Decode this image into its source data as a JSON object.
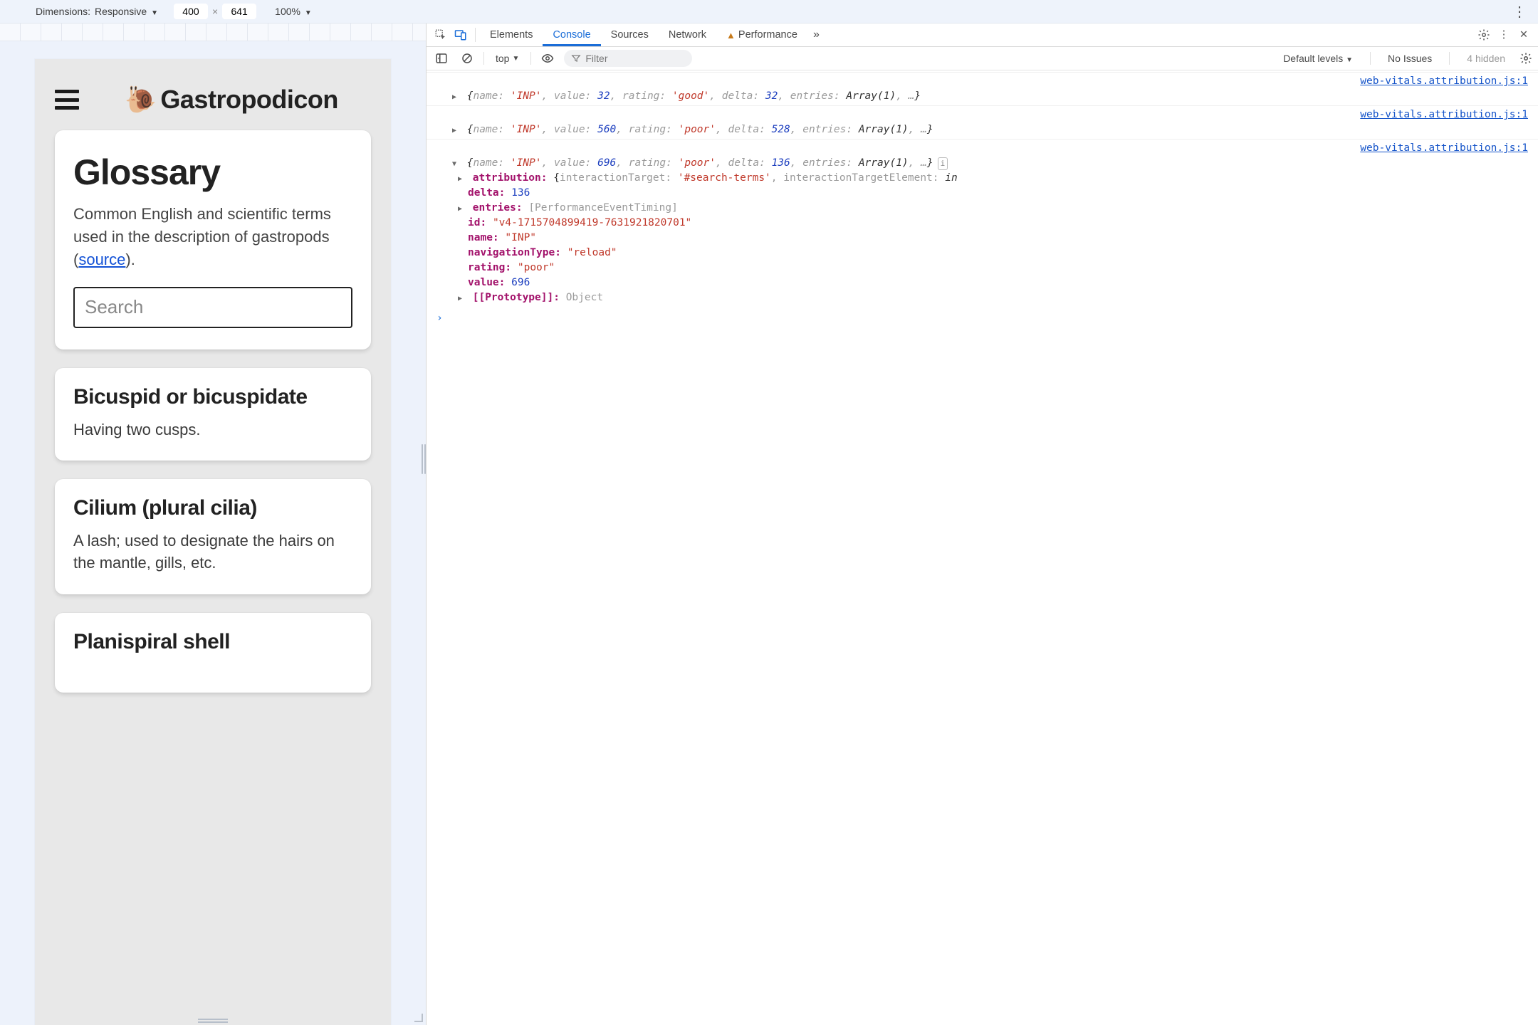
{
  "device_bar": {
    "dimensions_label": "Dimensions:",
    "device_name": "Responsive",
    "width": "400",
    "height": "641",
    "zoom": "100%"
  },
  "site": {
    "title": "Gastropodicon",
    "page_title": "Glossary",
    "lead_pre": "Common English and scientific terms used in the description of gastropods (",
    "lead_link": "source",
    "lead_post": ").",
    "search_placeholder": "Search",
    "terms": [
      {
        "title": "Bicuspid or bicuspidate",
        "def": "Having two cusps."
      },
      {
        "title": "Cilium (plural cilia)",
        "def": "A lash; used to designate the hairs on the mantle, gills, etc."
      },
      {
        "title": "Planispiral shell",
        "def": ""
      }
    ]
  },
  "devtools": {
    "tabs": {
      "elements": "Elements",
      "console": "Console",
      "sources": "Sources",
      "network": "Network",
      "performance": "Performance"
    },
    "toolbar": {
      "context": "top",
      "filter_placeholder": "Filter",
      "levels": "Default levels",
      "no_issues": "No Issues",
      "hidden": "4 hidden"
    },
    "source_link": "web-vitals.attribution.js:1",
    "logs": [
      {
        "expanded": false,
        "summary": [
          {
            "t": "brace",
            "v": "{"
          },
          {
            "t": "key",
            "v": "name: "
          },
          {
            "t": "str",
            "v": "'INP'"
          },
          {
            "t": "punc",
            "v": ", "
          },
          {
            "t": "key",
            "v": "value: "
          },
          {
            "t": "num",
            "v": "32"
          },
          {
            "t": "punc",
            "v": ", "
          },
          {
            "t": "key",
            "v": "rating: "
          },
          {
            "t": "str",
            "v": "'good'"
          },
          {
            "t": "punc",
            "v": ", "
          },
          {
            "t": "key",
            "v": "delta: "
          },
          {
            "t": "num",
            "v": "32"
          },
          {
            "t": "punc",
            "v": ", "
          },
          {
            "t": "key",
            "v": "entries: "
          },
          {
            "t": "type",
            "v": "Array(1)"
          },
          {
            "t": "punc",
            "v": ", …"
          },
          {
            "t": "brace",
            "v": "}"
          }
        ]
      },
      {
        "expanded": false,
        "summary": [
          {
            "t": "brace",
            "v": "{"
          },
          {
            "t": "key",
            "v": "name: "
          },
          {
            "t": "str",
            "v": "'INP'"
          },
          {
            "t": "punc",
            "v": ", "
          },
          {
            "t": "key",
            "v": "value: "
          },
          {
            "t": "num",
            "v": "560"
          },
          {
            "t": "punc",
            "v": ", "
          },
          {
            "t": "key",
            "v": "rating: "
          },
          {
            "t": "str",
            "v": "'poor'"
          },
          {
            "t": "punc",
            "v": ", "
          },
          {
            "t": "key",
            "v": "delta: "
          },
          {
            "t": "num",
            "v": "528"
          },
          {
            "t": "punc",
            "v": ", "
          },
          {
            "t": "key",
            "v": "entries: "
          },
          {
            "t": "type",
            "v": "Array(1)"
          },
          {
            "t": "punc",
            "v": ", …"
          },
          {
            "t": "brace",
            "v": "}"
          }
        ]
      },
      {
        "expanded": true,
        "summary": [
          {
            "t": "brace",
            "v": "{"
          },
          {
            "t": "key",
            "v": "name: "
          },
          {
            "t": "str",
            "v": "'INP'"
          },
          {
            "t": "punc",
            "v": ", "
          },
          {
            "t": "key",
            "v": "value: "
          },
          {
            "t": "num",
            "v": "696"
          },
          {
            "t": "punc",
            "v": ", "
          },
          {
            "t": "key",
            "v": "rating: "
          },
          {
            "t": "str",
            "v": "'poor'"
          },
          {
            "t": "punc",
            "v": ", "
          },
          {
            "t": "key",
            "v": "delta: "
          },
          {
            "t": "num",
            "v": "136"
          },
          {
            "t": "punc",
            "v": ", "
          },
          {
            "t": "key",
            "v": "entries: "
          },
          {
            "t": "type",
            "v": "Array(1)"
          },
          {
            "t": "punc",
            "v": ", …"
          },
          {
            "t": "brace",
            "v": "}"
          }
        ],
        "props": [
          {
            "tri": "closed",
            "key": "attribution",
            "val": [
              {
                "t": "brace",
                "v": "{"
              },
              {
                "t": "key",
                "v": "interactionTarget: "
              },
              {
                "t": "str",
                "v": "'#search-terms'"
              },
              {
                "t": "punc",
                "v": ", "
              },
              {
                "t": "key",
                "v": "interactionTargetElement: "
              },
              {
                "t": "type",
                "v": "in"
              }
            ]
          },
          {
            "tri": "",
            "key": "delta",
            "val": [
              {
                "t": "num",
                "v": "136"
              }
            ]
          },
          {
            "tri": "closed",
            "key": "entries",
            "val": [
              {
                "t": "punc",
                "v": "[PerformanceEventTiming]"
              }
            ]
          },
          {
            "tri": "",
            "key": "id",
            "val": [
              {
                "t": "str",
                "v": "\"v4-1715704899419-7631921820701\""
              }
            ]
          },
          {
            "tri": "",
            "key": "name",
            "val": [
              {
                "t": "str",
                "v": "\"INP\""
              }
            ]
          },
          {
            "tri": "",
            "key": "navigationType",
            "val": [
              {
                "t": "str",
                "v": "\"reload\""
              }
            ]
          },
          {
            "tri": "",
            "key": "rating",
            "val": [
              {
                "t": "str",
                "v": "\"poor\""
              }
            ]
          },
          {
            "tri": "",
            "key": "value",
            "val": [
              {
                "t": "num",
                "v": "696"
              }
            ]
          },
          {
            "tri": "closed",
            "key": "[[Prototype]]",
            "val": [
              {
                "t": "punc",
                "v": "Object"
              }
            ]
          }
        ]
      }
    ]
  }
}
